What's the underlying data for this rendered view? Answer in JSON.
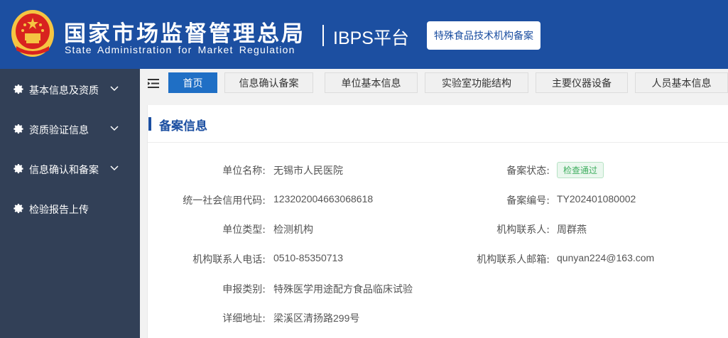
{
  "header": {
    "title_cn": "国家市场监督管理总局",
    "title_en": "State Administration  for  Market Regulation",
    "platform": "IBPS平台",
    "system_button": "特殊食品技术机构备案",
    "colors": {
      "brand": "#1c4fa1",
      "emblem_red": "#d8231f",
      "emblem_gold": "#f5c542"
    }
  },
  "sidebar": {
    "items": [
      {
        "label": "基本信息及资质",
        "icon": "gear-icon",
        "expandable": true
      },
      {
        "label": "资质验证信息",
        "icon": "gear-icon",
        "expandable": true
      },
      {
        "label": "信息确认和备案",
        "icon": "gear-icon",
        "expandable": true
      },
      {
        "label": "检验报告上传",
        "icon": "gear-icon",
        "expandable": false
      }
    ]
  },
  "tabs": [
    {
      "label": "首页",
      "active": true
    },
    {
      "label": "信息确认备案",
      "active": false
    },
    {
      "label": "单位基本信息",
      "active": false
    },
    {
      "label": "实验室功能结构",
      "active": false
    },
    {
      "label": "主要仪器设备",
      "active": false
    },
    {
      "label": "人员基本信息",
      "active": false
    }
  ],
  "card": {
    "title": "备案信息",
    "fields": {
      "unit_name": {
        "label": "单位名称:",
        "value": "无锡市人民医院"
      },
      "record_status": {
        "label": "备案状态:",
        "value": "检查通过"
      },
      "credit_code": {
        "label": "统一社会信用代码:",
        "value": "123202004663068618"
      },
      "record_no": {
        "label": "备案编号:",
        "value": "TY202401080002"
      },
      "unit_type": {
        "label": "单位类型:",
        "value": "检测机构"
      },
      "contact": {
        "label": "机构联系人:",
        "value": "周群燕"
      },
      "contact_phone": {
        "label": "机构联系人电话:",
        "value": "0510-85350713"
      },
      "contact_email": {
        "label": "机构联系人邮箱:",
        "value": "qunyan224@163.com"
      },
      "apply_type": {
        "label": "申报类别:",
        "value": "特殊医学用途配方食品临床试验"
      },
      "address": {
        "label": "详细地址:",
        "value": "梁溪区清扬路299号"
      }
    }
  }
}
